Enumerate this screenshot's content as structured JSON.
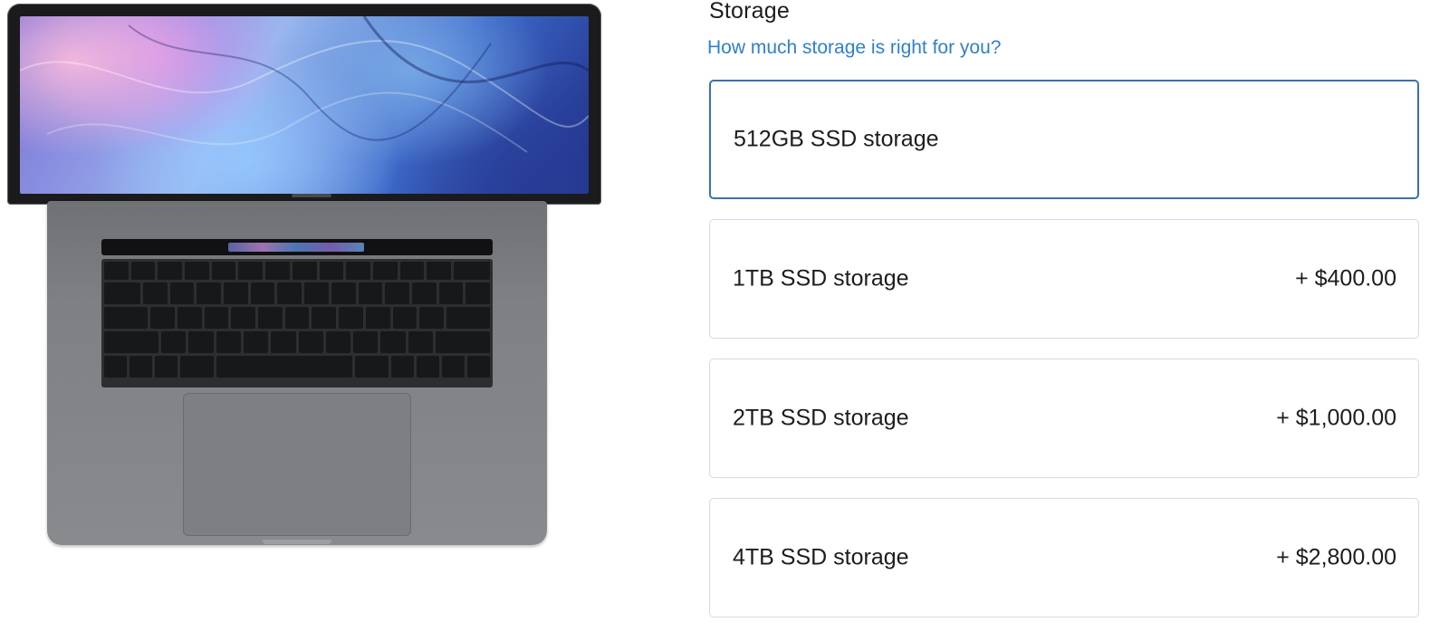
{
  "product": {
    "image_icon": "macbook-pro-illustration"
  },
  "storage": {
    "heading": "Storage",
    "help_link": "How much storage is right for you?",
    "accent_color": "#3b6fb5",
    "link_color": "#2f80d0",
    "options": [
      {
        "label": "512GB SSD storage",
        "price": "",
        "selected": true
      },
      {
        "label": "1TB SSD storage",
        "price": "+ $400.00",
        "selected": false
      },
      {
        "label": "2TB SSD storage",
        "price": "+ $1,000.00",
        "selected": false
      },
      {
        "label": "4TB SSD storage",
        "price": "+ $2,800.00",
        "selected": false
      }
    ]
  }
}
